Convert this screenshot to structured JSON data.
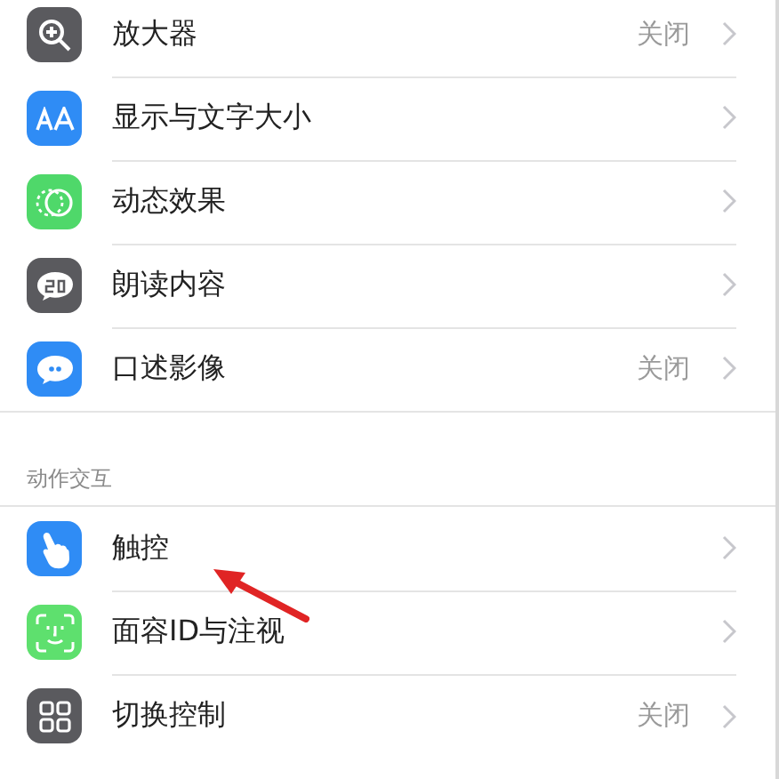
{
  "groups": [
    {
      "rows": [
        {
          "kind": "magnifier",
          "label": "放大器",
          "value": "关闭"
        },
        {
          "kind": "text-size",
          "label": "显示与文字大小"
        },
        {
          "kind": "motion",
          "label": "动态效果"
        },
        {
          "kind": "speech",
          "label": "朗读内容"
        },
        {
          "kind": "bubble",
          "label": "口述影像",
          "value": "关闭"
        }
      ]
    },
    {
      "header": "动作交互",
      "rows": [
        {
          "kind": "hand",
          "label": "触控"
        },
        {
          "kind": "face",
          "label": "面容ID与注视"
        },
        {
          "kind": "grid",
          "label": "切换控制",
          "value": "关闭"
        }
      ]
    }
  ]
}
